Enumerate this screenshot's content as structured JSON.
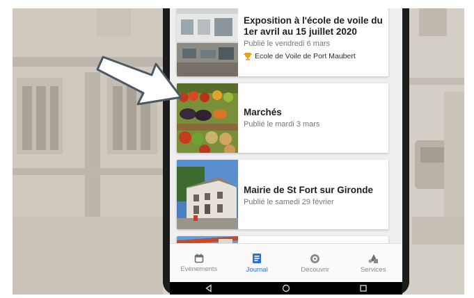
{
  "feed": {
    "items": [
      {
        "title": "Exposition à l'école de voile du 1er avril au 15 juillet 2020",
        "date": "Publié le vendredi 6 mars",
        "org": "Ecole de Voile de Port Maubert",
        "thumb_icon": "classroom-photo"
      },
      {
        "title": "Marchés",
        "date": "Publié le mardi 3 mars",
        "thumb_icon": "vegetables-photo"
      },
      {
        "title": "Mairie de St Fort sur Gironde",
        "date": "Publié le samedi 29 février",
        "thumb_icon": "town-hall-photo"
      }
    ]
  },
  "tabs": [
    {
      "label": "Evénements",
      "icon": "calendar-icon",
      "active": false
    },
    {
      "label": "Journal",
      "icon": "journal-icon",
      "active": true
    },
    {
      "label": "Découvrir",
      "icon": "compass-icon",
      "active": false
    },
    {
      "label": "Services",
      "icon": "services-icon",
      "active": false
    }
  ],
  "colors": {
    "accent": "#2d6fd6",
    "org_badge": "#e8a318",
    "background_illustration": "#d8d3cb"
  }
}
